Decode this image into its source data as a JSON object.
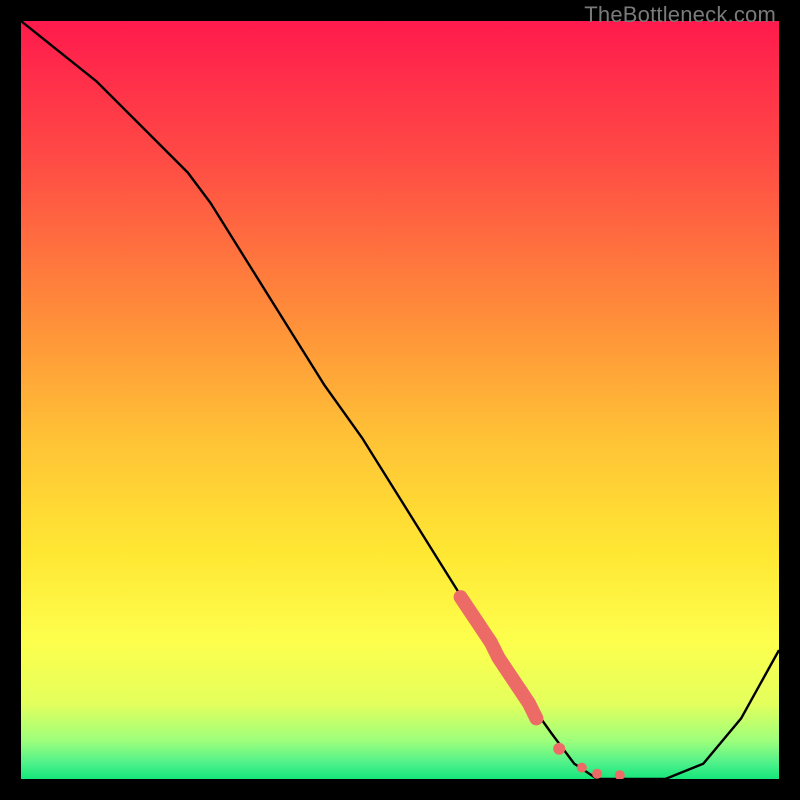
{
  "watermark": "TheBottleneck.com",
  "colors": {
    "gradient_top": "#ff1a4d",
    "gradient_mid_upper": "#ff6b3d",
    "gradient_mid": "#ffd633",
    "gradient_lower": "#fff94a",
    "gradient_near_bottom": "#d9ff66",
    "gradient_bottom": "#15e67a",
    "line": "#000000",
    "marker": "#ec6b66",
    "frame": "#000000"
  },
  "chart_data": {
    "type": "line",
    "title": "",
    "xlabel": "",
    "ylabel": "",
    "xlim": [
      0,
      100
    ],
    "ylim": [
      0,
      100
    ],
    "grid": false,
    "legend": false,
    "series": [
      {
        "name": "bottleneck-curve",
        "x": [
          0,
          5,
          10,
          15,
          20,
          22,
          25,
          30,
          35,
          40,
          45,
          50,
          55,
          60,
          63,
          65,
          70,
          73,
          76,
          80,
          85,
          90,
          95,
          100
        ],
        "y": [
          100,
          96,
          92,
          87,
          82,
          80,
          76,
          68,
          60,
          52,
          45,
          37,
          29,
          21,
          16,
          13,
          6,
          2,
          0,
          0,
          0,
          2,
          8,
          17
        ]
      }
    ],
    "markers": [
      {
        "name": "highlight-segment",
        "style": "thick-dash",
        "color": "#ec6b66",
        "x": [
          58,
          59,
          60,
          61,
          62,
          63,
          64,
          65,
          66,
          67,
          68
        ],
        "y": [
          24,
          22.5,
          21,
          19.5,
          18,
          16,
          14.5,
          13,
          11.5,
          10,
          8
        ]
      },
      {
        "name": "highlight-dots",
        "style": "dots",
        "color": "#ec6b66",
        "x": [
          71,
          74,
          76,
          79
        ],
        "y": [
          4,
          1.5,
          0.7,
          0.5
        ]
      }
    ]
  }
}
